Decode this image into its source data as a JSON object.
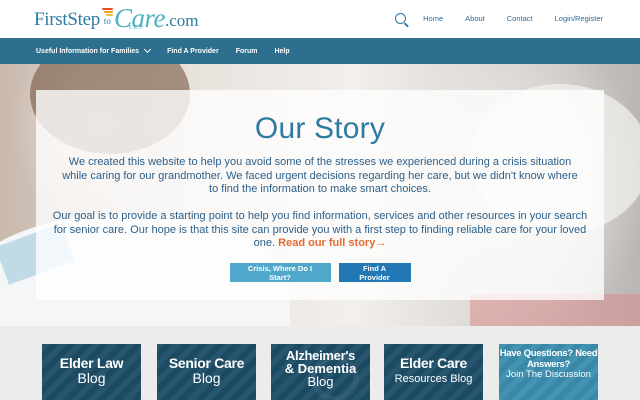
{
  "logo": {
    "first": "FirstStep",
    "to": "to",
    "care": "Care",
    "com": ".com",
    "llc": "LLC"
  },
  "topnav": {
    "items": [
      "Home",
      "About",
      "Contact",
      "Login/Register"
    ]
  },
  "mainnav": {
    "items": [
      "Useful Information for Families",
      "Find A Provider",
      "Forum",
      "Help"
    ]
  },
  "hero": {
    "title": "Our Story",
    "paragraph1": "We created this website to help you avoid some of the stresses we experienced during a crisis situation while caring for our grandmother. We faced urgent decisions regarding her care, but we didn't know where to find the information to make smart choices.",
    "paragraph2": "Our goal is to provide a starting point to help you find information, services and other resources in your search for senior care. Our hope is that this site can provide you with a first step to finding reliable care for your loved one.",
    "story_link": "Read our full story→",
    "button_crisis": "Crisis, Where Do I Start?",
    "button_provider": "Find A Provider"
  },
  "tiles": [
    {
      "line1": "Elder Law",
      "line2": "Blog"
    },
    {
      "line1": "Senior Care",
      "line2": "Blog"
    },
    {
      "line1": "Alzheimer's",
      "line1b": "& Dementia",
      "line2": "Blog"
    },
    {
      "line1": "Elder Care",
      "line2": "Resources Blog"
    },
    {
      "line1": "Have Questions? Need Answers?",
      "line2": "Join The Discussion"
    }
  ],
  "colors": {
    "brand_blue": "#2e7aa3",
    "nav_bar": "#2e6e8e",
    "link_orange": "#e26a32",
    "button_light": "#4fa8cc",
    "button_dark": "#2278b5",
    "tile_dark": "#1d4e67",
    "tile_light": "#3c8fb0"
  }
}
